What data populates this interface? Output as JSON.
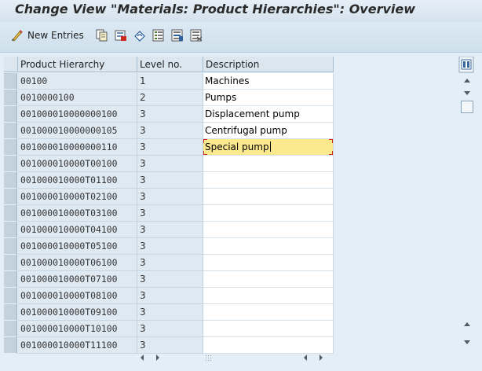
{
  "window": {
    "title": "Change View \"Materials: Product Hierarchies\": Overview"
  },
  "toolbar": {
    "new_entries_label": "New Entries",
    "icons": [
      "new-entries-icon",
      "copy-as-icon",
      "delete-icon",
      "undo-change-icon",
      "select-all-icon",
      "select-block-icon",
      "deselect-all-icon"
    ]
  },
  "table": {
    "columns": [
      "Product Hierarchy",
      "Level no.",
      "Description"
    ],
    "rows": [
      {
        "hierarchy": "00100",
        "level": "1",
        "description": "Machines"
      },
      {
        "hierarchy": "0010000100",
        "level": "2",
        "description": "Pumps"
      },
      {
        "hierarchy": "001000010000000100",
        "level": "3",
        "description": "Displacement pump"
      },
      {
        "hierarchy": "001000010000000105",
        "level": "3",
        "description": "Centrifugal pump"
      },
      {
        "hierarchy": "001000010000000110",
        "level": "3",
        "description": "Special pump"
      },
      {
        "hierarchy": "001000010000T00100",
        "level": "3",
        "description": ""
      },
      {
        "hierarchy": "001000010000T01100",
        "level": "3",
        "description": ""
      },
      {
        "hierarchy": "001000010000T02100",
        "level": "3",
        "description": ""
      },
      {
        "hierarchy": "001000010000T03100",
        "level": "3",
        "description": ""
      },
      {
        "hierarchy": "001000010000T04100",
        "level": "3",
        "description": ""
      },
      {
        "hierarchy": "001000010000T05100",
        "level": "3",
        "description": ""
      },
      {
        "hierarchy": "001000010000T06100",
        "level": "3",
        "description": ""
      },
      {
        "hierarchy": "001000010000T07100",
        "level": "3",
        "description": ""
      },
      {
        "hierarchy": "001000010000T08100",
        "level": "3",
        "description": ""
      },
      {
        "hierarchy": "001000010000T09100",
        "level": "3",
        "description": ""
      },
      {
        "hierarchy": "001000010000T10100",
        "level": "3",
        "description": ""
      },
      {
        "hierarchy": "001000010000T11100",
        "level": "3",
        "description": ""
      }
    ],
    "active_row": 4
  },
  "colors": {
    "accent_active": "#fde98d",
    "focus_corner": "#d0281b",
    "header_bg": "#dbe6ef"
  },
  "scrollbars": {
    "vertical": "visible",
    "horizontal": "visible"
  }
}
